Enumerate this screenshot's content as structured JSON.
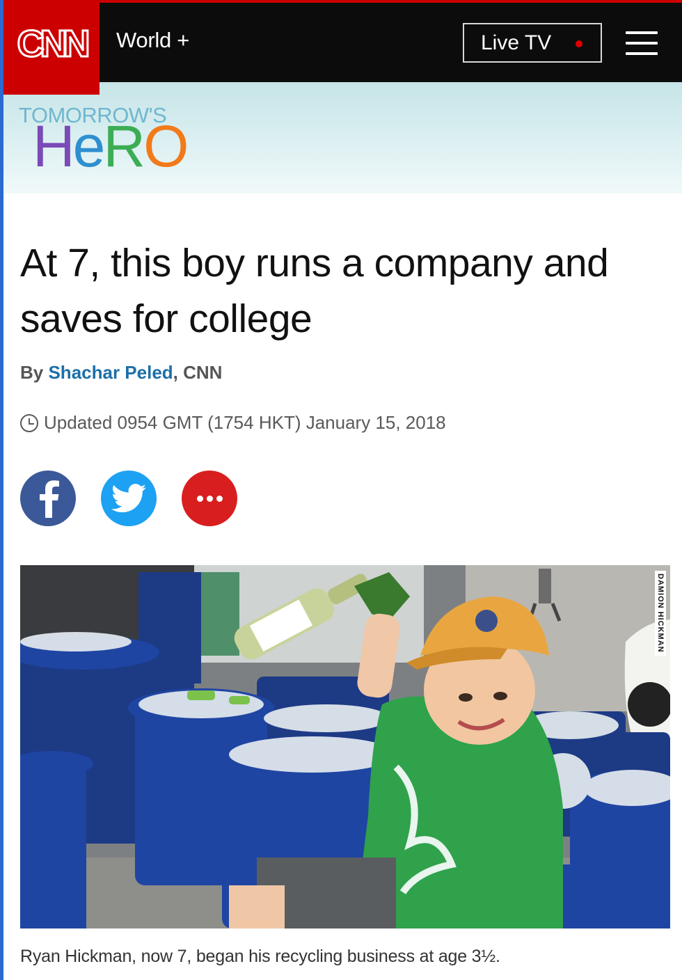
{
  "header": {
    "logo_text": "CNN",
    "section": "World +",
    "live_tv_label": "Live TV"
  },
  "banner": {
    "kicker": "TOMORROW'S",
    "title_parts": [
      "H",
      "e",
      "R",
      "O"
    ]
  },
  "article": {
    "headline": "At 7, this boy runs a company and saves for college",
    "byline_prefix": "By ",
    "author": "Shachar Peled",
    "byline_suffix": ", CNN",
    "timestamp": "Updated 0954 GMT (1754 HKT) January 15, 2018"
  },
  "share": {
    "facebook_icon": "facebook-icon",
    "twitter_icon": "twitter-icon",
    "more_icon": "more-dots-icon"
  },
  "photo": {
    "credit": "DAMION HICKMAN",
    "caption": "Ryan Hickman, now 7, began his recycling business at age 3½."
  },
  "colors": {
    "brand_red": "#cc0000",
    "header_black": "#0c0c0c",
    "author_blue": "#1d6fa8",
    "facebook": "#3b5998",
    "twitter": "#1da1f2",
    "more": "#d81e1e"
  }
}
